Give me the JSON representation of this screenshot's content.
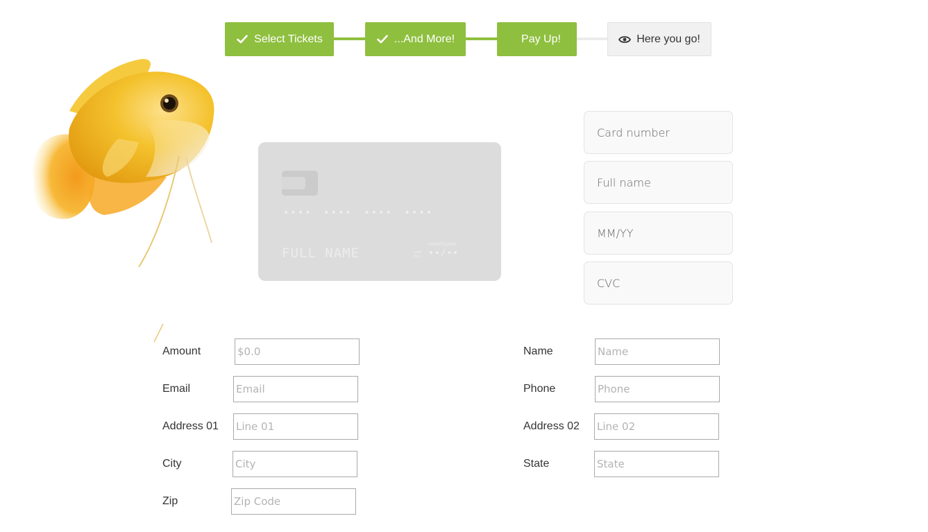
{
  "wizard": {
    "steps": [
      {
        "label": "Select Tickets",
        "state": "done",
        "icon": "check-icon"
      },
      {
        "label": "...And More!",
        "state": "done",
        "icon": "check-icon"
      },
      {
        "label": "Pay Up!",
        "state": "current",
        "icon": ""
      },
      {
        "label": "Here you go!",
        "state": "todo",
        "icon": "eye-icon"
      }
    ],
    "colors": {
      "done": "#8fbf3f",
      "todo": "#f1f1f1"
    }
  },
  "card_preview": {
    "number": "•••• •••• •••• ••••",
    "name": "FULL NAME",
    "valid_label": "valid thru",
    "month_year_label": "month/year",
    "expiry": "••/••"
  },
  "card_form": {
    "number_placeholder": "Card number",
    "name_placeholder": "Full name",
    "expiry_placeholder": "MM/YY",
    "cvc_placeholder": "CVC"
  },
  "billing": {
    "amount_label": "Amount",
    "amount_placeholder": "$0.0",
    "name_label": "Name",
    "name_placeholder": "Name",
    "email_label": "Email",
    "email_placeholder": "Email",
    "phone_label": "Phone",
    "phone_placeholder": "Phone",
    "address1_label": "Address 01",
    "address1_placeholder": "Line 01",
    "address2_label": "Address 02",
    "address2_placeholder": "Line 02",
    "city_label": "City",
    "city_placeholder": "City",
    "state_label": "State",
    "state_placeholder": "State",
    "zip_label": "Zip",
    "zip_placeholder": "Zip Code"
  }
}
